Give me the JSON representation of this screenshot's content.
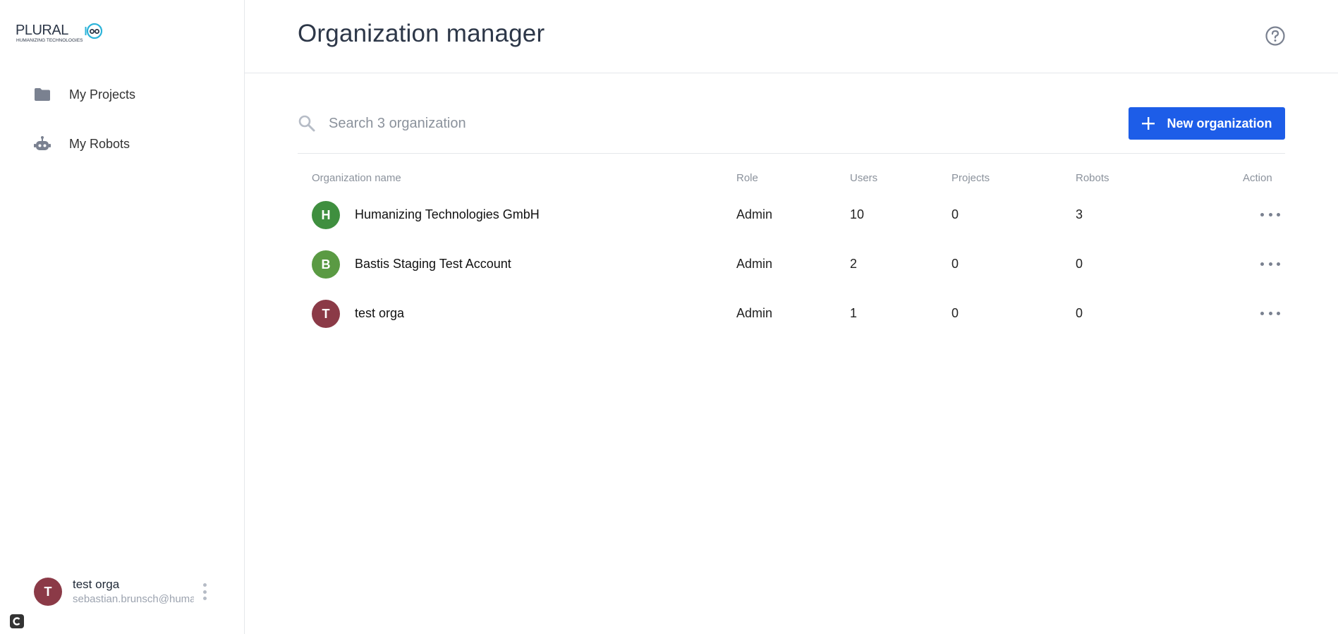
{
  "app": {
    "logo_text": "PLURAL",
    "logo_subtext": "HUMANIZING TECHNOLOGIES"
  },
  "sidebar": {
    "items": [
      {
        "label": "My Projects",
        "icon": "folder-icon"
      },
      {
        "label": "My Robots",
        "icon": "robot-icon"
      }
    ],
    "user": {
      "initial": "T",
      "name": "test orga",
      "email": "sebastian.brunsch@humar",
      "avatar_color": "#8b3a47"
    }
  },
  "header": {
    "title": "Organization manager",
    "help_icon": "help-circle-icon"
  },
  "toolbar": {
    "search_placeholder": "Search 3 organization",
    "new_button_label": "New organization",
    "accent": "#1d5de8"
  },
  "table": {
    "columns": {
      "name": "Organization name",
      "role": "Role",
      "users": "Users",
      "projects": "Projects",
      "robots": "Robots",
      "action": "Action"
    },
    "rows": [
      {
        "initial": "H",
        "name": "Humanizing Technologies GmbH",
        "role": "Admin",
        "users": "10",
        "projects": "0",
        "robots": "3",
        "color": "#3f8f3f"
      },
      {
        "initial": "B",
        "name": "Bastis Staging Test Account",
        "role": "Admin",
        "users": "2",
        "projects": "0",
        "robots": "0",
        "color": "#5a9a43"
      },
      {
        "initial": "T",
        "name": "test orga",
        "role": "Admin",
        "users": "1",
        "projects": "0",
        "robots": "0",
        "color": "#8b3a47"
      }
    ]
  }
}
